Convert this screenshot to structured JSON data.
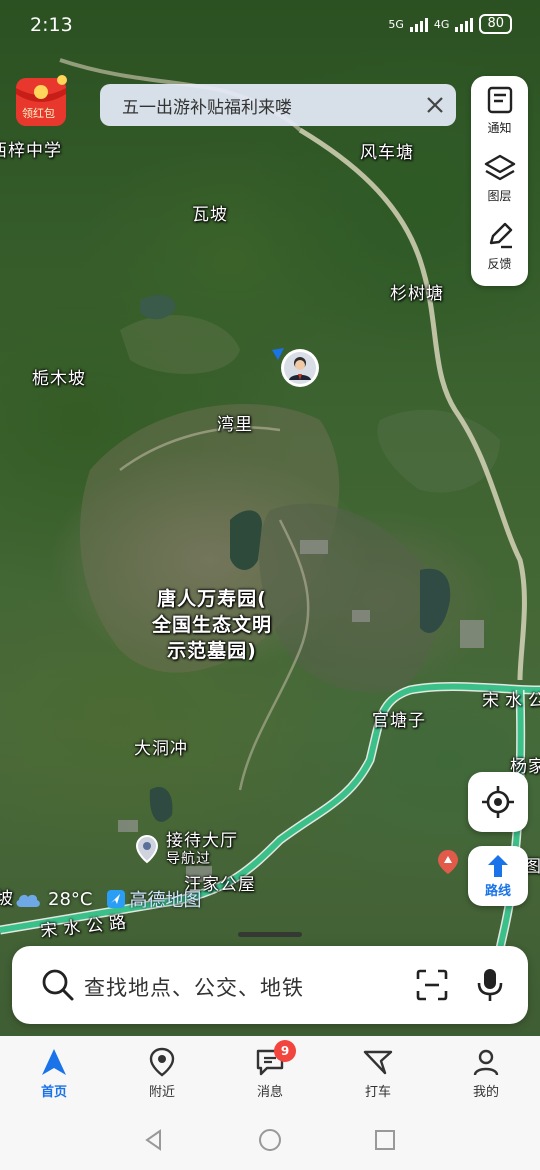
{
  "status_bar": {
    "time": "2:13",
    "net1": "5G",
    "net2": "4G",
    "battery": "80"
  },
  "red_packet": {
    "label": "领红包"
  },
  "notice": {
    "text": "五一出游补贴福利来喽"
  },
  "tools": [
    {
      "label": "通知",
      "icon": "notice-icon"
    },
    {
      "label": "图层",
      "icon": "layers-icon"
    },
    {
      "label": "反馈",
      "icon": "feedback-icon"
    }
  ],
  "map_labels": {
    "school": "西梓中学",
    "fengchetang": "风车塘",
    "wapo": "瓦坡",
    "shanshutang": "杉树塘",
    "zhimupo": "栀木坡",
    "wanli": "湾里",
    "tangren_1": "唐人万寿园(",
    "tangren_2": "全国生态文明",
    "tangren_3": "示范墓园)",
    "guantangzi": "官塘子",
    "dadongchong": "大洞冲",
    "jiedai": "接待大厅",
    "daohangguo": "导航过",
    "wangjiagongwu": "汪家公屋",
    "songshui_road_right": "宋水公",
    "songshui_road_left": "宋水公路",
    "yangjia": "杨家",
    "po_left": "坡",
    "tu_right": "图"
  },
  "weather": {
    "temp": "28°C",
    "icon": "cloud-icon",
    "brand": "高德地图"
  },
  "locate": {
    "icon": "locate-icon"
  },
  "route": {
    "label": "路线"
  },
  "search": {
    "placeholder": "查找地点、公交、地铁"
  },
  "nav": [
    {
      "label": "首页",
      "active": true
    },
    {
      "label": "附近",
      "active": false
    },
    {
      "label": "消息",
      "active": false,
      "badge": "9"
    },
    {
      "label": "打车",
      "active": false
    },
    {
      "label": "我的",
      "active": false
    }
  ],
  "colors": {
    "accent": "#1a73e8",
    "badge": "#f2453d",
    "road_green": "#3cc08a"
  }
}
